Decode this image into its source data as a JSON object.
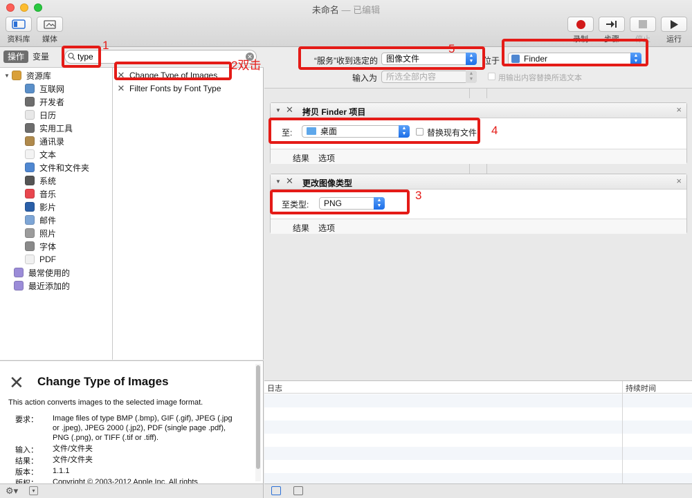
{
  "window": {
    "title": "未命名",
    "separator": "—",
    "subtitle": "已编辑"
  },
  "toolbar": {
    "library_label": "资料库",
    "media_label": "媒体",
    "record_label": "录制",
    "step_label": "步骤",
    "stop_label": "停止",
    "run_label": "运行"
  },
  "left": {
    "tabs": [
      "操作",
      "变量"
    ],
    "search_value": "type",
    "library": [
      {
        "label": "资源库",
        "icon": "library-icon",
        "color": "#d9a03a"
      },
      {
        "label": "互联网",
        "icon": "globe-icon",
        "color": "#5a8fc9"
      },
      {
        "label": "开发者",
        "icon": "tools-icon",
        "color": "#6d6d6d"
      },
      {
        "label": "日历",
        "icon": "calendar-icon",
        "color": "#e8e8e8"
      },
      {
        "label": "实用工具",
        "icon": "utilities-icon",
        "color": "#6d6d6d"
      },
      {
        "label": "通讯录",
        "icon": "contacts-icon",
        "color": "#b08a4c"
      },
      {
        "label": "文本",
        "icon": "text-icon",
        "color": "#f3f3f3"
      },
      {
        "label": "文件和文件夹",
        "icon": "finder-icon",
        "color": "#4f87d1"
      },
      {
        "label": "系统",
        "icon": "system-icon",
        "color": "#555555"
      },
      {
        "label": "音乐",
        "icon": "music-icon",
        "color": "#e8464e"
      },
      {
        "label": "影片",
        "icon": "movies-icon",
        "color": "#2a5fa8"
      },
      {
        "label": "邮件",
        "icon": "mail-icon",
        "color": "#7ea6d6"
      },
      {
        "label": "照片",
        "icon": "photos-icon",
        "color": "#9c9c9c"
      },
      {
        "label": "字体",
        "icon": "fonts-icon",
        "color": "#8a8a8a"
      },
      {
        "label": "PDF",
        "icon": "pdf-icon",
        "color": "#f0f0f0"
      },
      {
        "label": "最常使用的",
        "icon": "smart-folder-icon",
        "color": "#9b8cd8"
      },
      {
        "label": "最近添加的",
        "icon": "smart-folder-icon",
        "color": "#9b8cd8"
      }
    ],
    "actions": [
      "Change Type of Images",
      "Filter Fonts by Font Type"
    ]
  },
  "description": {
    "title": "Change Type of Images",
    "summary": "This action converts images to the selected image format.",
    "rows": [
      {
        "k": "要求：",
        "v": "Image files of type BMP (.bmp), GIF (.gif), JPEG (.jpg or .jpeg), JPEG 2000 (.jp2), PDF (single page .pdf), PNG (.png), or TIFF (.tif or .tiff)."
      },
      {
        "k": "输入：",
        "v": "文件/文件夹"
      },
      {
        "k": "结果：",
        "v": "文件/文件夹"
      },
      {
        "k": "版本：",
        "v": "1.1.1"
      },
      {
        "k": "版权：",
        "v": "Copyright © 2003-2012 Apple Inc.  All rights"
      }
    ]
  },
  "workflow": {
    "service_receives_label": "“服务”收到选定的",
    "service_receives_value": "图像文件",
    "in_label": "位于",
    "in_value": "Finder",
    "input_is_label": "输入为",
    "input_is_value": "所选全部内容",
    "replace_output_label": "用输出内容替换所选文本"
  },
  "card1": {
    "title": "拷贝 Finder 项目",
    "to_label": "至:",
    "to_value": "桌面",
    "replace_label": "替换现有文件",
    "results": "结果",
    "options": "选项"
  },
  "card2": {
    "title": "更改图像类型",
    "to_type_label": "至类型:",
    "to_type_value": "PNG",
    "results": "结果",
    "options": "选项"
  },
  "log": {
    "col_log": "日志",
    "col_duration": "持续时间"
  },
  "annotations": {
    "n1": "1",
    "n2": "2双击",
    "n3": "3",
    "n4": "4",
    "n5": "5"
  }
}
